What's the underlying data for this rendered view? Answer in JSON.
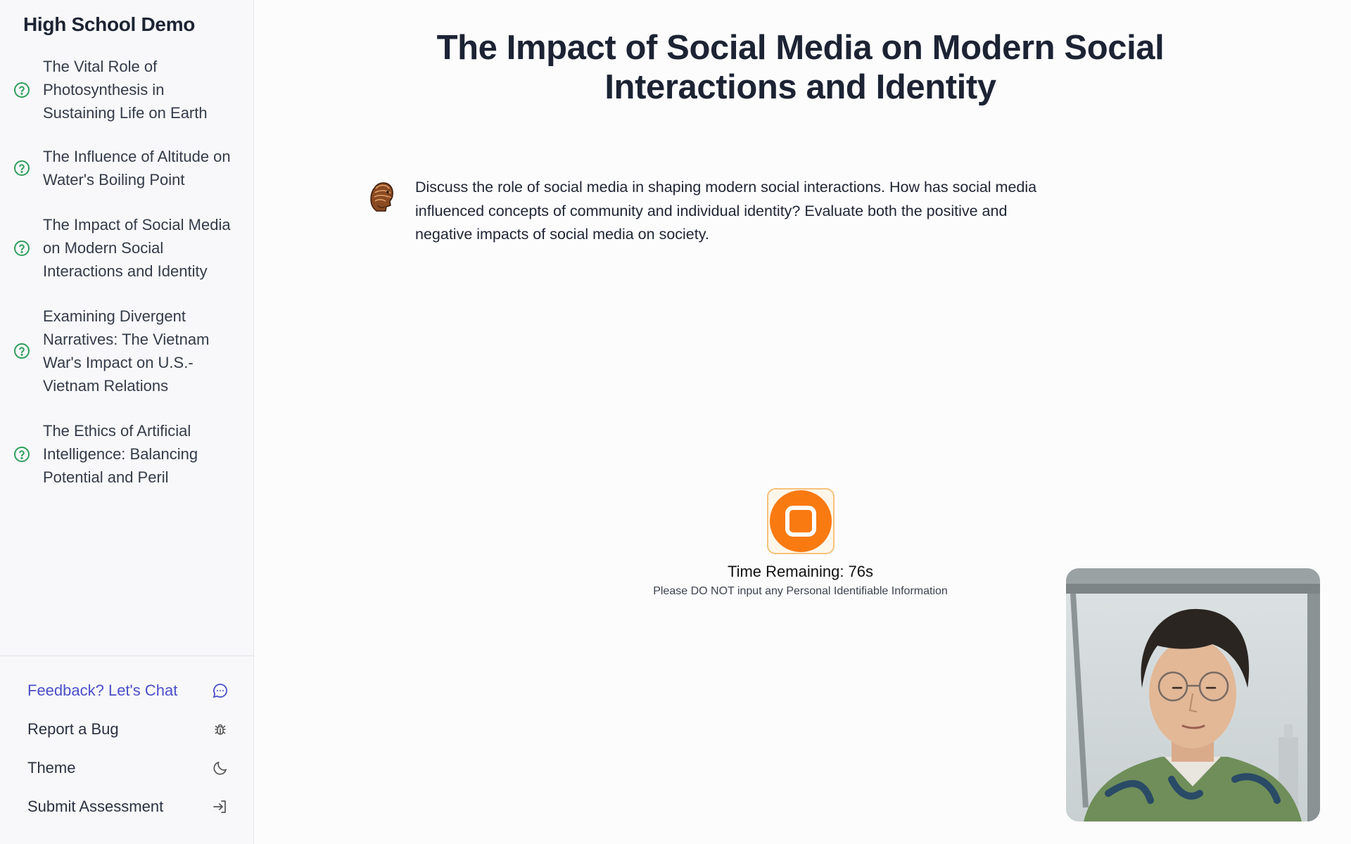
{
  "sidebar": {
    "app_title": "High School Demo",
    "topics": [
      {
        "label": "The Vital Role of Photosynthesis in Sustaining Life on Earth",
        "icon": "question-circle-icon"
      },
      {
        "label": "The Influence of Altitude on Water's Boiling Point",
        "icon": "question-circle-icon"
      },
      {
        "label": "The Impact of Social Media on Modern Social Interactions and Identity",
        "icon": "question-circle-icon"
      },
      {
        "label": "Examining Divergent Narratives: The Vietnam War's Impact on U.S.-Vietnam Relations",
        "icon": "question-circle-icon"
      },
      {
        "label": "The Ethics of Artificial Intelligence: Balancing Potential and Peril",
        "icon": "question-circle-icon"
      }
    ],
    "footer": {
      "feedback": {
        "label": "Feedback? Let's Chat",
        "icon": "chat-bubble-icon"
      },
      "bug": {
        "label": "Report a Bug",
        "icon": "bug-icon"
      },
      "theme": {
        "label": "Theme",
        "icon": "moon-icon"
      },
      "submit": {
        "label": "Submit Assessment",
        "icon": "sign-in-icon"
      }
    }
  },
  "main": {
    "title": "The Impact of Social Media on Modern Social Interactions and Identity",
    "prompt": "Discuss the role of social media in shaping modern social interactions. How has social media influenced concepts of community and individual identity? Evaluate both the positive and negative impacts of social media on society.",
    "stop_icon": "stop-icon",
    "timer": "Time Remaining: 76s",
    "pii_notice": "Please DO NOT input any Personal Identifiable Information"
  },
  "colors": {
    "accent_green": "#2e9e5b",
    "feedback_blue": "#4b4fc9",
    "record_orange": "#f97a10",
    "title_text": "#1c2333"
  }
}
